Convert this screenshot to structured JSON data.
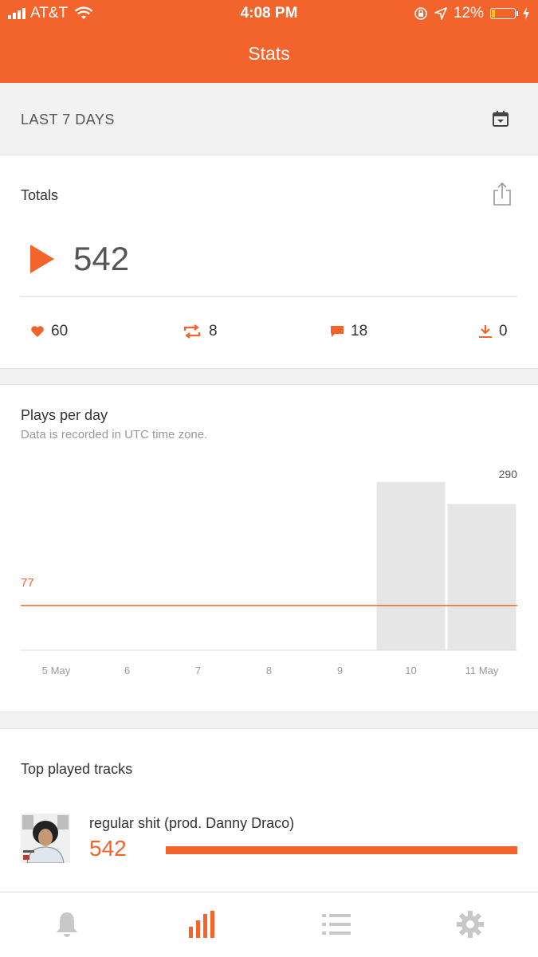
{
  "status_bar": {
    "carrier": "AT&T",
    "time": "4:08 PM",
    "battery": "12%",
    "battery_level": 0.12
  },
  "nav": {
    "title": "Stats"
  },
  "range": {
    "label": "LAST 7 DAYS",
    "icon": "calendar-icon"
  },
  "totals": {
    "title": "Totals",
    "plays": "542",
    "likes": "60",
    "reposts": "8",
    "comments": "18",
    "downloads": "0",
    "icons": [
      "play-icon",
      "heart-icon",
      "repost-icon",
      "comment-icon",
      "download-icon",
      "share-icon"
    ]
  },
  "plays_per_day": {
    "title": "Plays per day",
    "subtitle": "Data is recorded in UTC time zone."
  },
  "chart_data": {
    "type": "bar",
    "categories": [
      "5 May",
      "6",
      "7",
      "8",
      "9",
      "10",
      "11 May"
    ],
    "values": [
      0,
      0,
      0,
      0,
      0,
      290,
      252
    ],
    "average_line": 77,
    "max_label": "290",
    "average_label": "77",
    "ylim": [
      0,
      320
    ],
    "grid": false,
    "colors": {
      "bars": "#e6e6e6",
      "average": "#f2642b"
    }
  },
  "top_tracks": {
    "title": "Top played tracks",
    "items": [
      {
        "name": "regular shit (prod. Danny Draco)",
        "plays": "542",
        "share": 1.0
      }
    ]
  },
  "tabs": [
    {
      "name": "notifications",
      "icon": "bell-icon",
      "active": false
    },
    {
      "name": "stats",
      "icon": "stats-icon",
      "active": true
    },
    {
      "name": "tracks",
      "icon": "list-icon",
      "active": false
    },
    {
      "name": "settings",
      "icon": "gear-icon",
      "active": false
    }
  ],
  "colors": {
    "accent": "#f2642b",
    "inactive": "#c8c8c8",
    "background": "#f2f2f2"
  }
}
